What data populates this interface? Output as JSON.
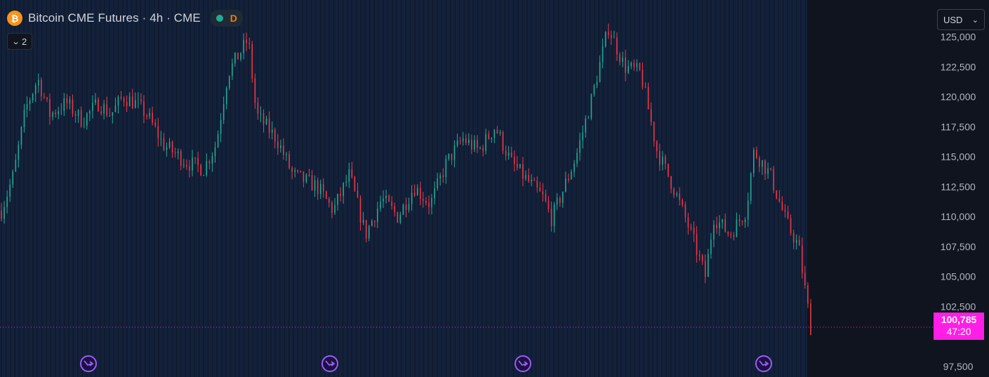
{
  "header": {
    "symbol_title": "Bitcoin CME Futures · 4h · CME",
    "logo_glyph": "₿",
    "status_letter": "D",
    "indicator_count": "2"
  },
  "currency_selector": {
    "label": "USD"
  },
  "last_price": {
    "value": "100,785",
    "countdown": "47:20"
  },
  "colors": {
    "background": "#0f141e",
    "session_band": "#13213b",
    "up": "#22ab94",
    "down": "#f23645",
    "last_price_tag": "#ff1ee6",
    "event_marker": "#9c5cf7",
    "axis_text": "#b2b5be"
  },
  "icons": {
    "logo": "bitcoin-icon",
    "collapse": "chevron-down-icon",
    "currency": "chevron-down-icon",
    "events": "dividend-arrow-icon"
  },
  "chart_data": {
    "type": "candlestick",
    "timeframe": "4h",
    "y_ticks": [
      97500,
      102500,
      105000,
      107500,
      110000,
      112500,
      115000,
      117500,
      120000,
      122500,
      125000
    ],
    "y_tick_labels": [
      "97,500",
      "102,500",
      "105,000",
      "107,500",
      "110,000",
      "112,500",
      "115,000",
      "117,500",
      "120,000",
      "122,500",
      "125,000"
    ],
    "ylim": [
      96800,
      127600
    ],
    "last_price": 100785,
    "close_path": [
      [
        0,
        110500
      ],
      [
        0.015,
        113500
      ],
      [
        0.03,
        119000
      ],
      [
        0.045,
        121500
      ],
      [
        0.06,
        118500
      ],
      [
        0.08,
        119500
      ],
      [
        0.1,
        118000
      ],
      [
        0.12,
        119500
      ],
      [
        0.135,
        118500
      ],
      [
        0.15,
        120000
      ],
      [
        0.165,
        119500
      ],
      [
        0.18,
        118500
      ],
      [
        0.2,
        116000
      ],
      [
        0.23,
        114500
      ],
      [
        0.25,
        114000
      ],
      [
        0.265,
        116000
      ],
      [
        0.28,
        122000
      ],
      [
        0.305,
        124800
      ],
      [
        0.315,
        118500
      ],
      [
        0.34,
        116500
      ],
      [
        0.36,
        113500
      ],
      [
        0.39,
        112500
      ],
      [
        0.41,
        110500
      ],
      [
        0.43,
        113500
      ],
      [
        0.45,
        108500
      ],
      [
        0.47,
        111500
      ],
      [
        0.49,
        110000
      ],
      [
        0.51,
        112500
      ],
      [
        0.53,
        111000
      ],
      [
        0.55,
        114500
      ],
      [
        0.57,
        116500
      ],
      [
        0.59,
        115500
      ],
      [
        0.61,
        117500
      ],
      [
        0.63,
        114500
      ],
      [
        0.65,
        113000
      ],
      [
        0.67,
        111500
      ],
      [
        0.68,
        109800
      ],
      [
        0.71,
        115000
      ],
      [
        0.73,
        120000
      ],
      [
        0.75,
        125800
      ],
      [
        0.77,
        122500
      ],
      [
        0.79,
        122000
      ],
      [
        0.81,
        115500
      ],
      [
        0.83,
        112500
      ],
      [
        0.85,
        109000
      ],
      [
        0.87,
        105000
      ],
      [
        0.88,
        110000
      ],
      [
        0.9,
        108500
      ],
      [
        0.92,
        110500
      ],
      [
        0.93,
        115500
      ],
      [
        0.95,
        113500
      ],
      [
        0.97,
        109500
      ],
      [
        0.985,
        107500
      ],
      [
        1.0,
        100800
      ]
    ],
    "series": [
      {
        "name": "",
        "color_up": "#22ab94",
        "color_down": "#f23645"
      }
    ],
    "event_markers": 4
  }
}
